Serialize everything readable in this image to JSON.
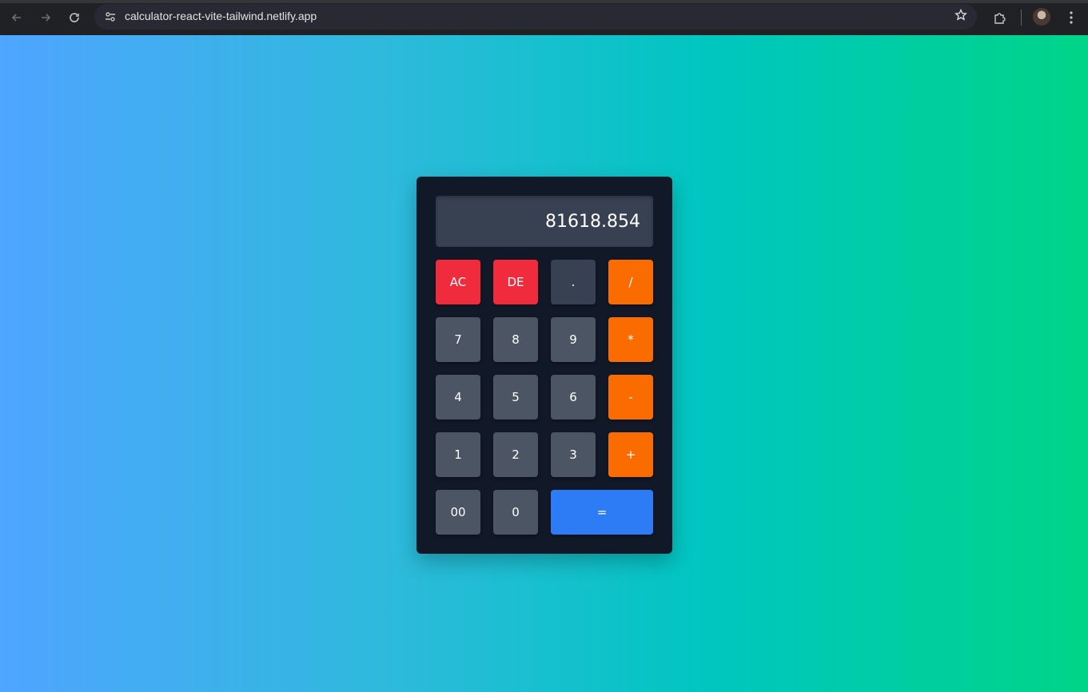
{
  "browser": {
    "url": "calculator-react-vite-tailwind.netlify.app"
  },
  "calculator": {
    "display_value": "81618.854",
    "keys": {
      "ac": "AC",
      "de": "DE",
      "dot": ".",
      "divide": "/",
      "seven": "7",
      "eight": "8",
      "nine": "9",
      "multiply": "*",
      "four": "4",
      "five": "5",
      "six": "6",
      "minus": "-",
      "one": "1",
      "two": "2",
      "three": "3",
      "plus": "+",
      "double_zero": "00",
      "zero": "0",
      "equals": "="
    }
  },
  "colors": {
    "clear_keys": "#ef2b3c",
    "number_keys": "#4b5563",
    "operator_keys": "#fb6c00",
    "equals_key": "#2d7cf6",
    "calculator_body": "#111827",
    "display_background": "#374151"
  }
}
